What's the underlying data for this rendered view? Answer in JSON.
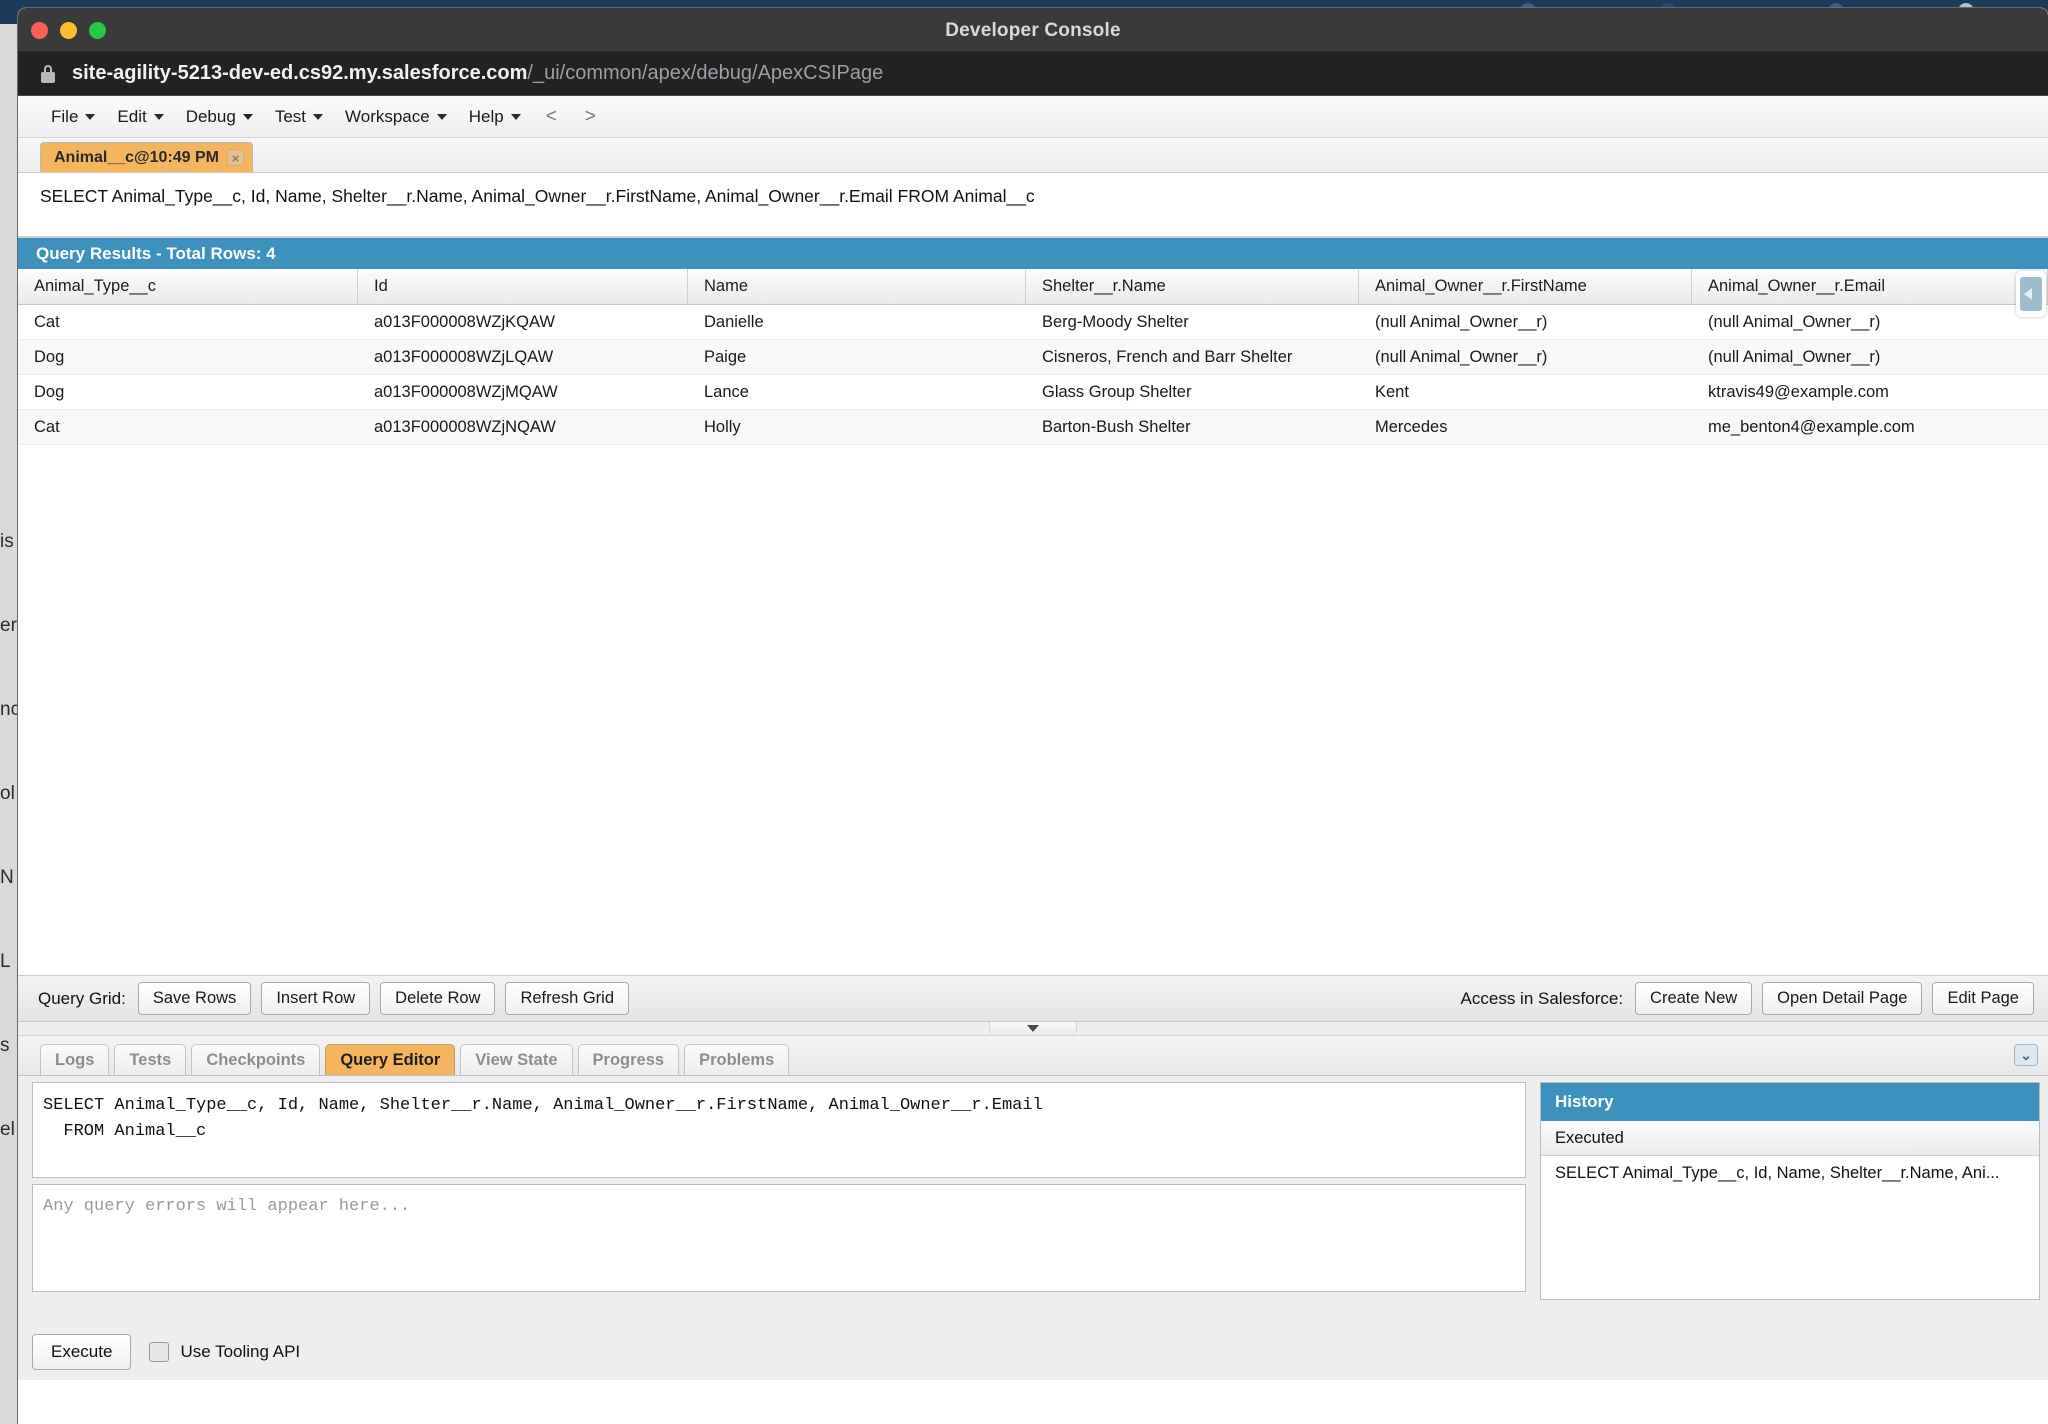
{
  "browser": {
    "navy_bar_color": "#1b3a5c",
    "window_title": "Developer Console",
    "url_host": "site-agility-5213-dev-ed.cs92.my.salesforce.com",
    "url_path": "/_ui/common/apex/debug/ApexCSIPage",
    "lock_icon": "lock-icon",
    "traffic_lights": [
      "close-red",
      "minimize-yellow",
      "maximize-green"
    ],
    "background_edge_text": [
      "is",
      "er",
      "nc",
      "ol",
      "N",
      "L",
      "s",
      "el"
    ]
  },
  "menubar": {
    "items": [
      {
        "label": "File",
        "has_caret": true
      },
      {
        "label": "Edit",
        "has_caret": true
      },
      {
        "label": "Debug",
        "has_caret": true
      },
      {
        "label": "Test",
        "has_caret": true
      },
      {
        "label": "Workspace",
        "has_caret": true
      },
      {
        "label": "Help",
        "has_caret": true
      }
    ],
    "nav_prev": "<",
    "nav_next": ">"
  },
  "editor_tab": {
    "label": "Animal__c@10:49 PM",
    "close_label": "×",
    "active_color": "#f5b55f"
  },
  "query_display": {
    "text": "SELECT Animal_Type__c, Id, Name, Shelter__r.Name, Animal_Owner__r.FirstName, Animal_Owner__r.Email FROM Animal__c"
  },
  "results": {
    "header": "Query Results - Total Rows: 4",
    "header_color": "#3d92bd",
    "columns": [
      "Animal_Type__c",
      "Id",
      "Name",
      "Shelter__r.Name",
      "Animal_Owner__r.FirstName",
      "Animal_Owner__r.Email"
    ],
    "rows": [
      [
        "Cat",
        "a013F000008WZjKQAW",
        "Danielle",
        "Berg-Moody Shelter",
        "(null Animal_Owner__r)",
        "(null Animal_Owner__r)"
      ],
      [
        "Dog",
        "a013F000008WZjLQAW",
        "Paige",
        "Cisneros, French and Barr Shelter",
        "(null Animal_Owner__r)",
        "(null Animal_Owner__r)"
      ],
      [
        "Dog",
        "a013F000008WZjMQAW",
        "Lance",
        "Glass Group Shelter",
        "Kent",
        "ktravis49@example.com"
      ],
      [
        "Cat",
        "a013F000008WZjNQAW",
        "Holly",
        "Barton-Bush Shelter",
        "Mercedes",
        "me_benton4@example.com"
      ]
    ]
  },
  "gridbar": {
    "left_label": "Query Grid:",
    "left_buttons": [
      "Save Rows",
      "Insert Row",
      "Delete Row",
      "Refresh Grid"
    ],
    "right_label": "Access in Salesforce:",
    "right_buttons": [
      "Create New",
      "Open Detail Page",
      "Edit Page"
    ]
  },
  "bottom_tabs": {
    "items": [
      "Logs",
      "Tests",
      "Checkpoints",
      "Query Editor",
      "View State",
      "Progress",
      "Problems"
    ],
    "active": "Query Editor",
    "expand_all_icon": "chevron-double-down-icon"
  },
  "soql_editor": {
    "value": "SELECT Animal_Type__c, Id, Name, Shelter__r.Name, Animal_Owner__r.FirstName, Animal_Owner__r.Email\n  FROM Animal__c"
  },
  "error_box": {
    "placeholder": "Any query errors will appear here..."
  },
  "history": {
    "title": "History",
    "column": "Executed",
    "rows": [
      "SELECT Animal_Type__c, Id, Name, Shelter__r.Name, Ani..."
    ]
  },
  "footer": {
    "execute_label": "Execute",
    "tooling_label": "Use Tooling API",
    "tooling_checked": false
  }
}
